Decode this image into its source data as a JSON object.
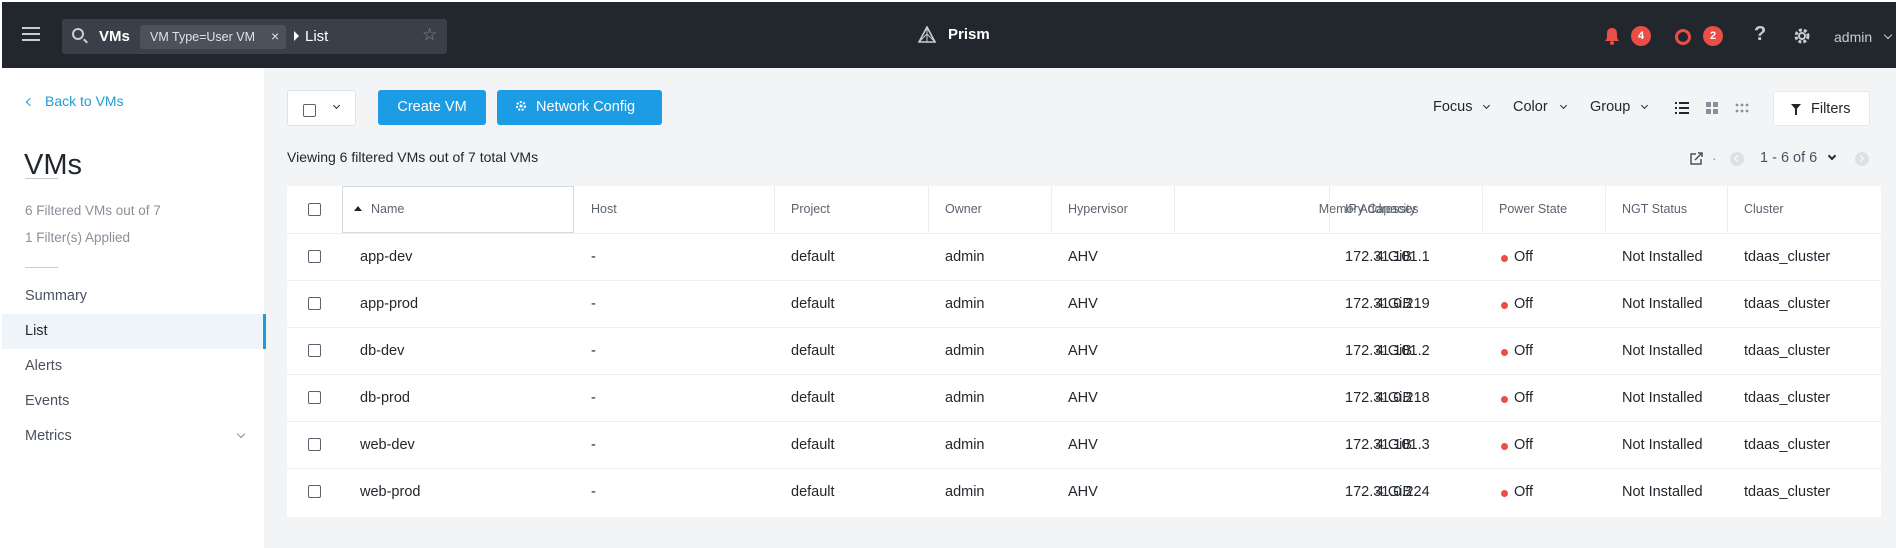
{
  "header": {
    "search_context": "VMs",
    "filter_chip": "VM Type=User VM",
    "filter_chip_close": "×",
    "view": "List",
    "app_name": "Prism",
    "alerts_count": "4",
    "tasks_count": "2",
    "help": "?",
    "user": "admin"
  },
  "sidebar": {
    "back_label": "Back to VMs",
    "title": "VMs",
    "filtered_summary": "6 Filtered VMs out of 7",
    "filters_applied": "1 Filter(s) Applied",
    "items": [
      {
        "label": "Summary"
      },
      {
        "label": "List"
      },
      {
        "label": "Alerts"
      },
      {
        "label": "Events"
      },
      {
        "label": "Metrics"
      }
    ]
  },
  "toolbar": {
    "create_vm": "Create VM",
    "network_config": "Network Config",
    "focus": "Focus",
    "color": "Color",
    "group": "Group",
    "filters": "Filters",
    "viewing_text": "Viewing 6 filtered VMs out of 7 total VMs",
    "pager_text": "1 - 6 of 6"
  },
  "table": {
    "columns": [
      "Name",
      "Host",
      "Project",
      "Owner",
      "Hypervisor",
      "Memory Capacity",
      "IP Addresses",
      "Power State",
      "NGT Status",
      "Cluster"
    ],
    "rows": [
      {
        "name": "app-dev",
        "host": "-",
        "project": "default",
        "owner": "admin",
        "hypervisor": "AHV",
        "memory": "4 GiB",
        "ip": "172.31.101.1",
        "power": "Off",
        "ngt": "Not Installed",
        "cluster": "tdaas_cluster"
      },
      {
        "name": "app-prod",
        "host": "-",
        "project": "default",
        "owner": "admin",
        "hypervisor": "AHV",
        "memory": "4 GiB",
        "ip": "172.31.0.219",
        "power": "Off",
        "ngt": "Not Installed",
        "cluster": "tdaas_cluster"
      },
      {
        "name": "db-dev",
        "host": "-",
        "project": "default",
        "owner": "admin",
        "hypervisor": "AHV",
        "memory": "4 GiB",
        "ip": "172.31.101.2",
        "power": "Off",
        "ngt": "Not Installed",
        "cluster": "tdaas_cluster"
      },
      {
        "name": "db-prod",
        "host": "-",
        "project": "default",
        "owner": "admin",
        "hypervisor": "AHV",
        "memory": "4 GiB",
        "ip": "172.31.0.218",
        "power": "Off",
        "ngt": "Not Installed",
        "cluster": "tdaas_cluster"
      },
      {
        "name": "web-dev",
        "host": "-",
        "project": "default",
        "owner": "admin",
        "hypervisor": "AHV",
        "memory": "4 GiB",
        "ip": "172.31.101.3",
        "power": "Off",
        "ngt": "Not Installed",
        "cluster": "tdaas_cluster"
      },
      {
        "name": "web-prod",
        "host": "-",
        "project": "default",
        "owner": "admin",
        "hypervisor": "AHV",
        "memory": "4 GiB",
        "ip": "172.31.0.224",
        "power": "Off",
        "ngt": "Not Installed",
        "cluster": "tdaas_cluster"
      }
    ]
  },
  "colors": {
    "topbar": "#22272e",
    "accent": "#1b9ce3",
    "alert_red": "#ea4e45",
    "background": "#f2f4f6"
  },
  "icons": [
    "menu-icon",
    "search-icon",
    "star-icon",
    "prism-logo-icon",
    "bell-icon",
    "task-ring-icon",
    "help-icon",
    "gear-icon",
    "list-view-icon",
    "grid-view-icon",
    "tile-view-icon",
    "filter-icon",
    "export-icon"
  ]
}
